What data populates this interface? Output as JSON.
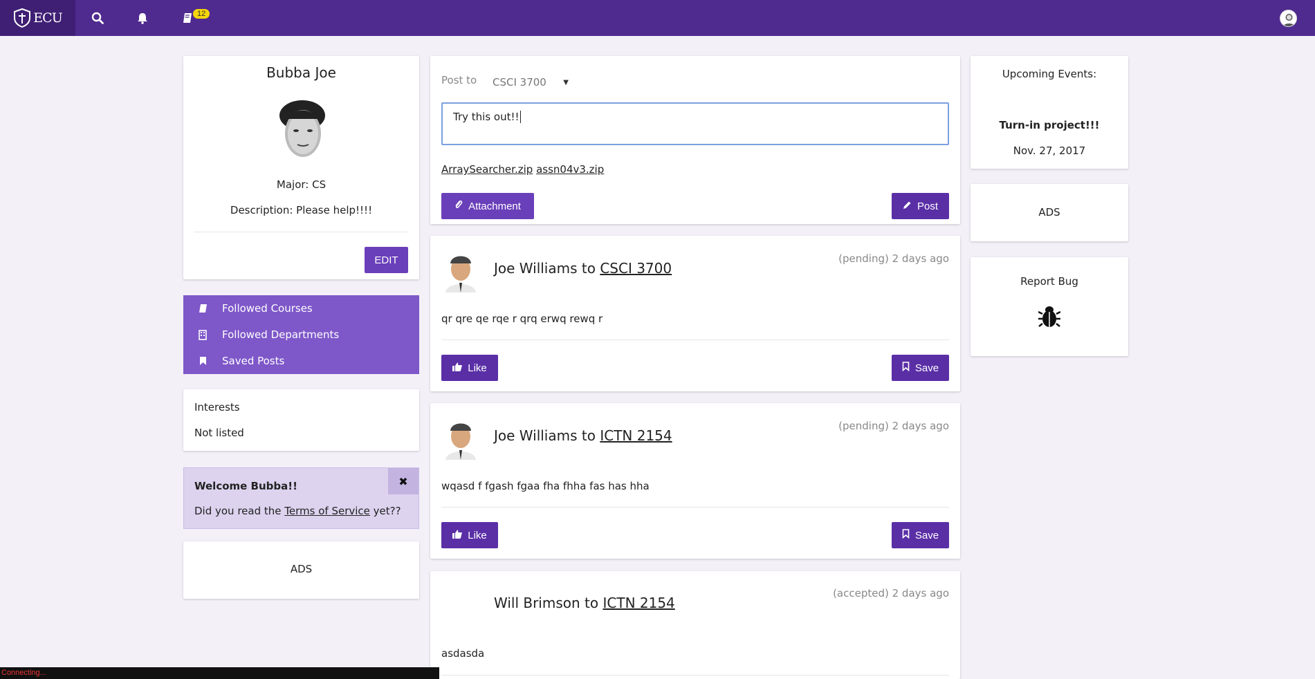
{
  "topbar": {
    "logo_text": "ECU",
    "notification_badge": "12"
  },
  "profile": {
    "name": "Bubba Joe",
    "major": "Major: CS",
    "description": "Description: Please help!!!!",
    "edit_label": "EDIT"
  },
  "menu": {
    "items": [
      {
        "label": "Followed Courses",
        "icon": "book-icon"
      },
      {
        "label": "Followed Departments",
        "icon": "building-icon"
      },
      {
        "label": "Saved Posts",
        "icon": "bookmark-icon"
      }
    ]
  },
  "interests": {
    "title": "Interests",
    "value": "Not listed"
  },
  "notice": {
    "title": "Welcome Bubba!!",
    "text_before": "Did you read the ",
    "link": "Terms of Service",
    "text_after": " yet??",
    "close": "✖"
  },
  "ads_left": "ADS",
  "composer": {
    "post_to_label": "Post to",
    "selected_course": "CSCI 3700",
    "text": "Try this out!!",
    "attachments": [
      "ArraySearcher.zip",
      "assn04v3.zip"
    ],
    "attachment_label": "Attachment",
    "post_label": "Post"
  },
  "posts": [
    {
      "author": "Joe Williams",
      "to": " to ",
      "course": "CSCI 3700",
      "time": "(pending) 2 days ago",
      "body": "qr qre qe rqe r qrq erwq rewq r",
      "like": "Like",
      "save": "Save"
    },
    {
      "author": "Joe Williams",
      "to": " to ",
      "course": "ICTN 2154",
      "time": "(pending) 2 days ago",
      "body": "wqasd f fgash fgaa fha fhha fas has hha",
      "like": "Like",
      "save": "Save"
    },
    {
      "author": "Will Brimson",
      "to": " to ",
      "course": "ICTN 2154",
      "time": "(accepted) 2 days ago",
      "body": "asdasda"
    }
  ],
  "events": {
    "title": "Upcoming Events:",
    "event_name": "Turn-in project!!!",
    "event_date": "Nov. 27, 2017"
  },
  "ads_right": "ADS",
  "report_bug": {
    "title": "Report Bug",
    "icon": "bug-icon"
  },
  "status_bar": "Connecting...",
  "colors": {
    "topbar": "#4f2a8f",
    "button": "#6a3fba",
    "menu": "#7e57c9",
    "badge": "#f4d50b"
  }
}
